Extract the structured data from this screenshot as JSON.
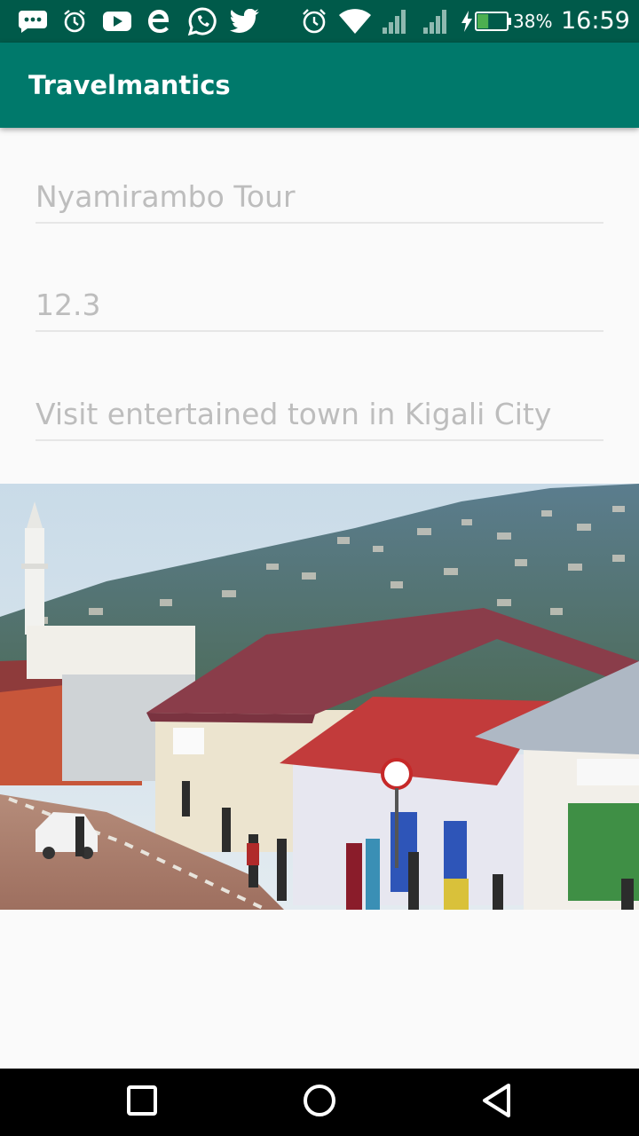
{
  "status_bar": {
    "notification_icons": [
      "chat-icon",
      "alarm-icon",
      "youtube-icon",
      "browser-icon",
      "whatsapp-icon",
      "twitter-icon"
    ],
    "system_icons": [
      "alarm-icon",
      "wifi-icon",
      "signal-icon",
      "signal-icon",
      "charging-icon",
      "battery-icon"
    ],
    "battery_percent": "38%",
    "battery_level": 0.38,
    "time": "16:59"
  },
  "toolbar": {
    "title": "Travelmantics"
  },
  "form": {
    "title_value": "Nyamirambo Tour",
    "price_value": "12.3",
    "description_value": "Visit entertained town in Kigali City"
  },
  "colors": {
    "status_bar": "#005a4a",
    "toolbar": "#00796b",
    "background": "#fafafa",
    "field_text": "#bdbdbd"
  },
  "nav_bar": {
    "buttons": [
      "recents-icon",
      "home-icon",
      "back-icon"
    ]
  }
}
